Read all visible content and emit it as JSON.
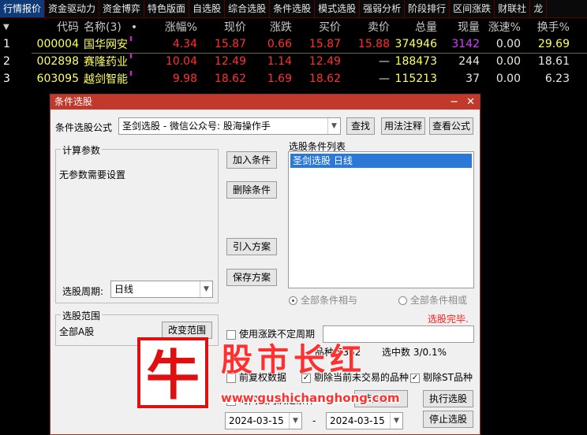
{
  "tabs": [
    "行情报价",
    "资金驱动力",
    "资金博弈",
    "特色版面",
    "自选股",
    "综合选股",
    "条件选股",
    "模式选股",
    "强弱分析",
    "阶段排行",
    "区间涨跌",
    "财联社",
    "龙"
  ],
  "table": {
    "sort_icon": "sort-down-icon",
    "headers": [
      "",
      "代码",
      "名称(3)",
      "涨幅%",
      "现价",
      "涨跌",
      "买价",
      "卖价",
      "总量",
      "现量",
      "涨速%",
      "换手%"
    ],
    "rows": [
      {
        "idx": "1",
        "code": "000004",
        "name": "国华网安",
        "chg_pct": "4.34",
        "price": "15.87",
        "chg": "0.66",
        "bid": "15.87",
        "ask": "15.88",
        "vol": "374946",
        "cur_vol": "3142",
        "speed": "0.00",
        "turnover": "29.69"
      },
      {
        "idx": "2",
        "code": "002898",
        "name": "赛隆药业",
        "chg_pct": "10.04",
        "price": "12.49",
        "chg": "1.14",
        "bid": "12.49",
        "ask": "—",
        "vol": "188473",
        "cur_vol": "244",
        "speed": "0.00",
        "turnover": "18.61"
      },
      {
        "idx": "3",
        "code": "603095",
        "name": "越剑智能",
        "chg_pct": "9.98",
        "price": "18.62",
        "chg": "1.69",
        "bid": "18.62",
        "ask": "—",
        "vol": "115213",
        "cur_vol": "37",
        "speed": "0.00",
        "turnover": "6.23"
      }
    ]
  },
  "dialog": {
    "title": "条件选股",
    "formula_label": "条件选股公式",
    "formula_value": "圣剑选股    - 微信公众号: 股海操作手",
    "find": "查找",
    "usage": "用法注释",
    "view_formula": "查看公式",
    "params_group": "计算参数",
    "no_params": "无参数需要设置",
    "period_label": "选股周期:",
    "period_value": "日线",
    "add_cond": "加入条件",
    "del_cond": "删除条件",
    "import_plan": "引入方案",
    "save_plan": "保存方案",
    "list_title": "选股条件列表",
    "list_item": "圣剑选股  日线",
    "radio_and": "全部条件相与",
    "radio_or": "全部条件相或",
    "status": "选股完毕.",
    "range_group": "选股范围",
    "range_value": "全部A股",
    "change_range": "改变范围",
    "use_period": "使用涨跌不定周期",
    "stock_count_label": "品种",
    "stock_count": "5362",
    "hit_label": "选中数",
    "hit_value": "3/0.1%",
    "pre_data": "前复权数据",
    "exclude_notrade": "剔除当前未交易的品种",
    "exclude_st": "剔除ST品种",
    "time_cond": "时间段内满足条件",
    "to_board": "选入板块",
    "run": "执行选股",
    "stop": "停止选股",
    "date_from": "2024-03-15",
    "date_sep": "-",
    "date_to": "2024-03-15"
  },
  "watermark": {
    "char": "牛",
    "title": "股市长红",
    "url": "www.gushichanghong.com"
  },
  "colors": {
    "up": "#ff3030",
    "code": "#ffff60",
    "title_bar": "#c0392b",
    "selected": "#2a78d8"
  }
}
